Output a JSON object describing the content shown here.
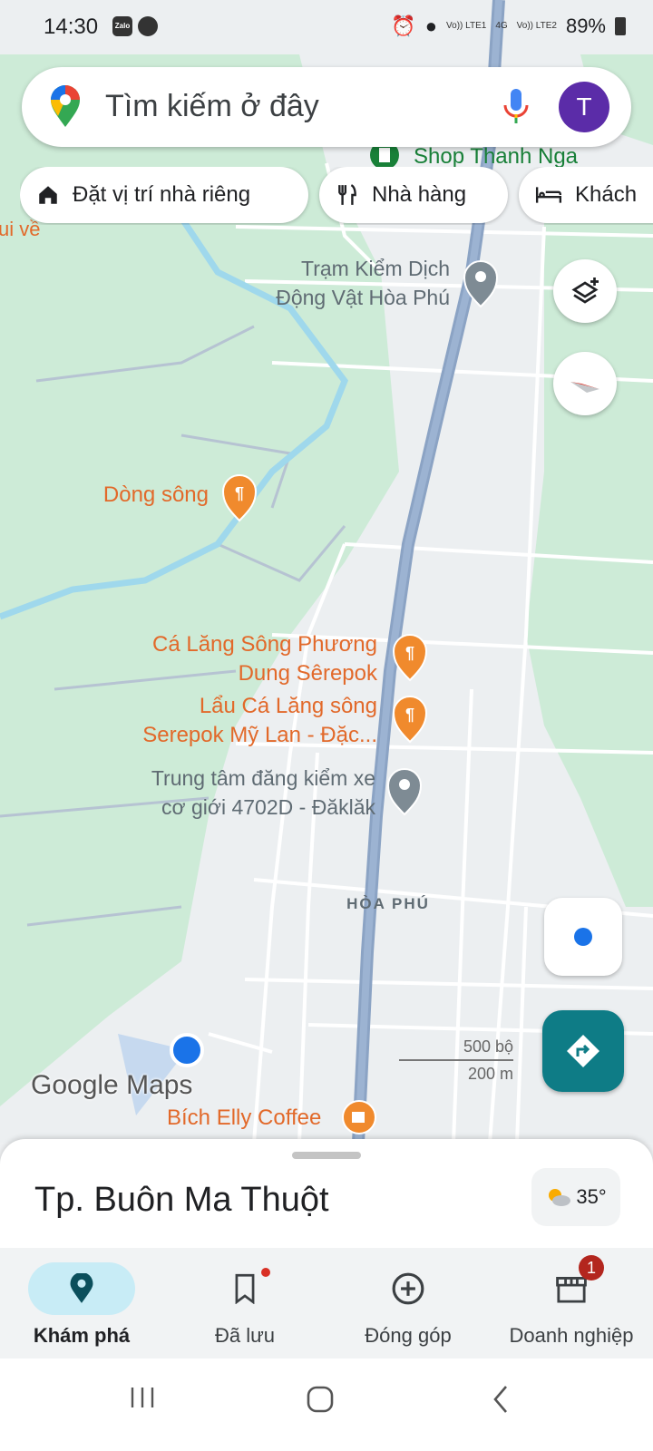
{
  "status_bar": {
    "time": "14:30",
    "app_icons": [
      "zalo-icon",
      "messenger-icon"
    ],
    "sim1": "Vo)) LTE1",
    "net": "4G",
    "sim2": "Vo)) LTE2",
    "battery": "89%"
  },
  "search": {
    "placeholder": "Tìm kiếm ở đây",
    "avatar_letter": "T"
  },
  "chips": [
    {
      "label": "Đặt vị trí nhà riêng",
      "icon": "home-icon"
    },
    {
      "label": "Nhà hàng",
      "icon": "restaurant-icon"
    },
    {
      "label": "Khách",
      "icon": "hotel-icon"
    }
  ],
  "map": {
    "labels": {
      "edge_label": "ui về",
      "shop": "Shop Thanh Nga",
      "tram_line1": "Trạm Kiểm Dịch",
      "tram_line2": "Động Vật Hòa Phú",
      "dong_song": "Dòng sông",
      "calang_line1": "Cá Lăng Sông Phương",
      "calang_line2": "Dung Sêrepok",
      "lau_line1": "Lẩu Cá Lăng sông",
      "lau_line2": "Serepok Mỹ Lan -  Đặc...",
      "trungtam_line1": "Trung tâm đăng kiểm xe",
      "trungtam_line2": "cơ giới 4702D - Đăklăk",
      "district": "HÒA PHÚ",
      "coffee": "Bích Elly Coffee"
    },
    "scale": {
      "feet": "500 bộ",
      "meters": "200 m"
    },
    "logo": "Google Maps",
    "colors": {
      "green": "#cdebd7",
      "land": "#eceff1",
      "river": "#9fd8ec",
      "highway": "#8ba3c4",
      "poi_orange": "#f08a2d",
      "poi_gray": "#7e8b94"
    }
  },
  "sheet": {
    "city": "Tp. Buôn Ma Thuột",
    "temperature": "35°"
  },
  "bottom_nav": [
    {
      "label": "Khám phá",
      "icon": "explore-pin-icon",
      "active": true
    },
    {
      "label": "Đã lưu",
      "icon": "bookmark-icon",
      "dot": true
    },
    {
      "label": "Đóng góp",
      "icon": "add-circle-icon"
    },
    {
      "label": "Doanh nghiệp",
      "icon": "store-icon",
      "badge": "1"
    }
  ]
}
